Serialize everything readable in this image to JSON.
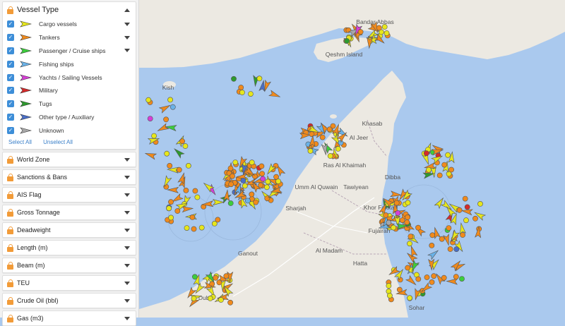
{
  "vessel_type": {
    "header": "Vessel Type",
    "items": [
      {
        "label": "Cargo vessels",
        "color": "#e6e61c",
        "expandable": true
      },
      {
        "label": "Tankers",
        "color": "#f08a1c",
        "expandable": true
      },
      {
        "label": "Passenger / Cruise ships",
        "color": "#3ccd3c",
        "expandable": true
      },
      {
        "label": "Fishing ships",
        "color": "#6ab2e8",
        "expandable": false
      },
      {
        "label": "Yachts / Sailing Vessels",
        "color": "#d63ed6",
        "expandable": false
      },
      {
        "label": "Military",
        "color": "#d42a2a",
        "expandable": false
      },
      {
        "label": "Tugs",
        "color": "#2e9a2e",
        "expandable": false
      },
      {
        "label": "Other type / Auxiliary",
        "color": "#4a6ec6",
        "expandable": false
      },
      {
        "label": "Unknown",
        "color": "#a8a8a8",
        "expandable": false
      }
    ],
    "select_all": "Select All",
    "unselect_all": "Unselect All"
  },
  "filters": [
    {
      "label": "World Zone"
    },
    {
      "label": "Sanctions & Bans"
    },
    {
      "label": "AIS Flag"
    },
    {
      "label": "Gross Tonnage"
    },
    {
      "label": "Deadweight"
    },
    {
      "label": "Length (m)"
    },
    {
      "label": "Beam (m)"
    },
    {
      "label": "TEU"
    },
    {
      "label": "Crude Oil (bbl)"
    },
    {
      "label": "Gas (m3)"
    }
  ],
  "map": {
    "colors": {
      "water": "#aac9ee",
      "land": "#ece9e2",
      "road": "#ffffff",
      "border": "#b9a7b6",
      "text": "#555555"
    },
    "places": [
      "Bandar Abbas",
      "Qeshm Island",
      "Kish",
      "Khasab",
      "Al Jeer",
      "Ras Al Khaimah",
      "Dibba",
      "Umm Al Quwain",
      "Tawiyean",
      "Sharjah",
      "Khor Fakkan",
      "Fujairah",
      "Al Madam",
      "Ganout",
      "Hatta",
      "Dubai",
      "Sohar"
    ]
  }
}
